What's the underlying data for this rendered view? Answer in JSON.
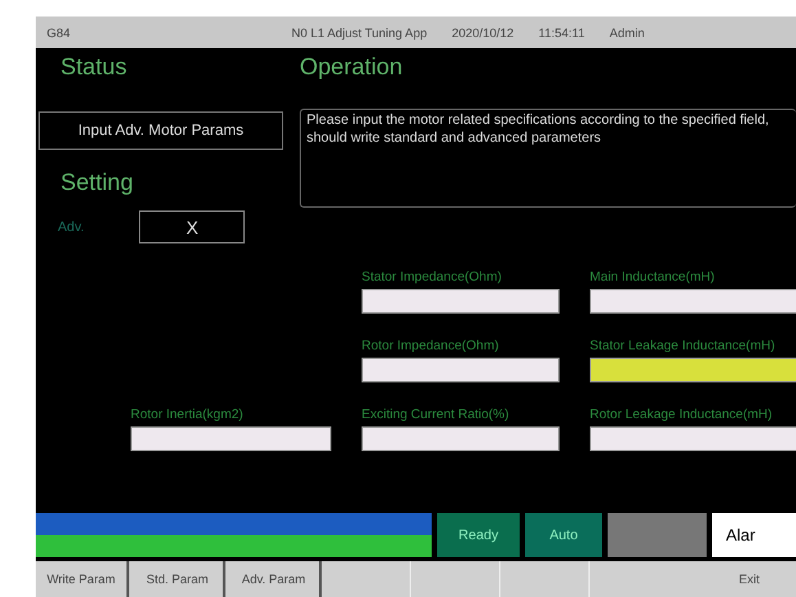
{
  "header": {
    "screen_id": "G84",
    "app": "N0 L1 Adjust Tuning App",
    "date": "2020/10/12",
    "time": "11:54:11",
    "user": "Admin"
  },
  "status_title": "Status",
  "operation_title": "Operation",
  "status_button": "Input Adv. Motor Params",
  "message": "Please input the motor related specifications according to the specified field, should write standard and advanced parameters",
  "setting_title": "Setting",
  "adv": {
    "label": "Adv.",
    "value": "X"
  },
  "field_columns": [
    [
      {
        "label": "Rotor Inertia(kgm2)",
        "highlighted": false
      }
    ],
    [
      {
        "label": "Stator Impedance(Ohm)",
        "highlighted": false
      },
      {
        "label": "Rotor Impedance(Ohm)",
        "highlighted": false
      },
      {
        "label": "Exciting Current Ratio(%)",
        "highlighted": false
      }
    ],
    [
      {
        "label": "Main Inductance(mH)",
        "highlighted": false
      },
      {
        "label": "Stator Leakage Inductance(mH)",
        "highlighted": true
      },
      {
        "label": "Rotor Leakage Inductance(mH)",
        "highlighted": false
      }
    ]
  ],
  "status_bar": {
    "ready": "Ready",
    "mode": "Auto",
    "alarm": "Alar"
  },
  "buttons": [
    {
      "kind": "text",
      "label": "Write Param"
    },
    {
      "kind": "text",
      "label": "Std. Param"
    },
    {
      "kind": "text",
      "label": "Adv. Param"
    },
    {
      "kind": "blank"
    },
    {
      "kind": "blank"
    },
    {
      "kind": "blank"
    },
    {
      "kind": "text",
      "label": "Exit"
    }
  ]
}
